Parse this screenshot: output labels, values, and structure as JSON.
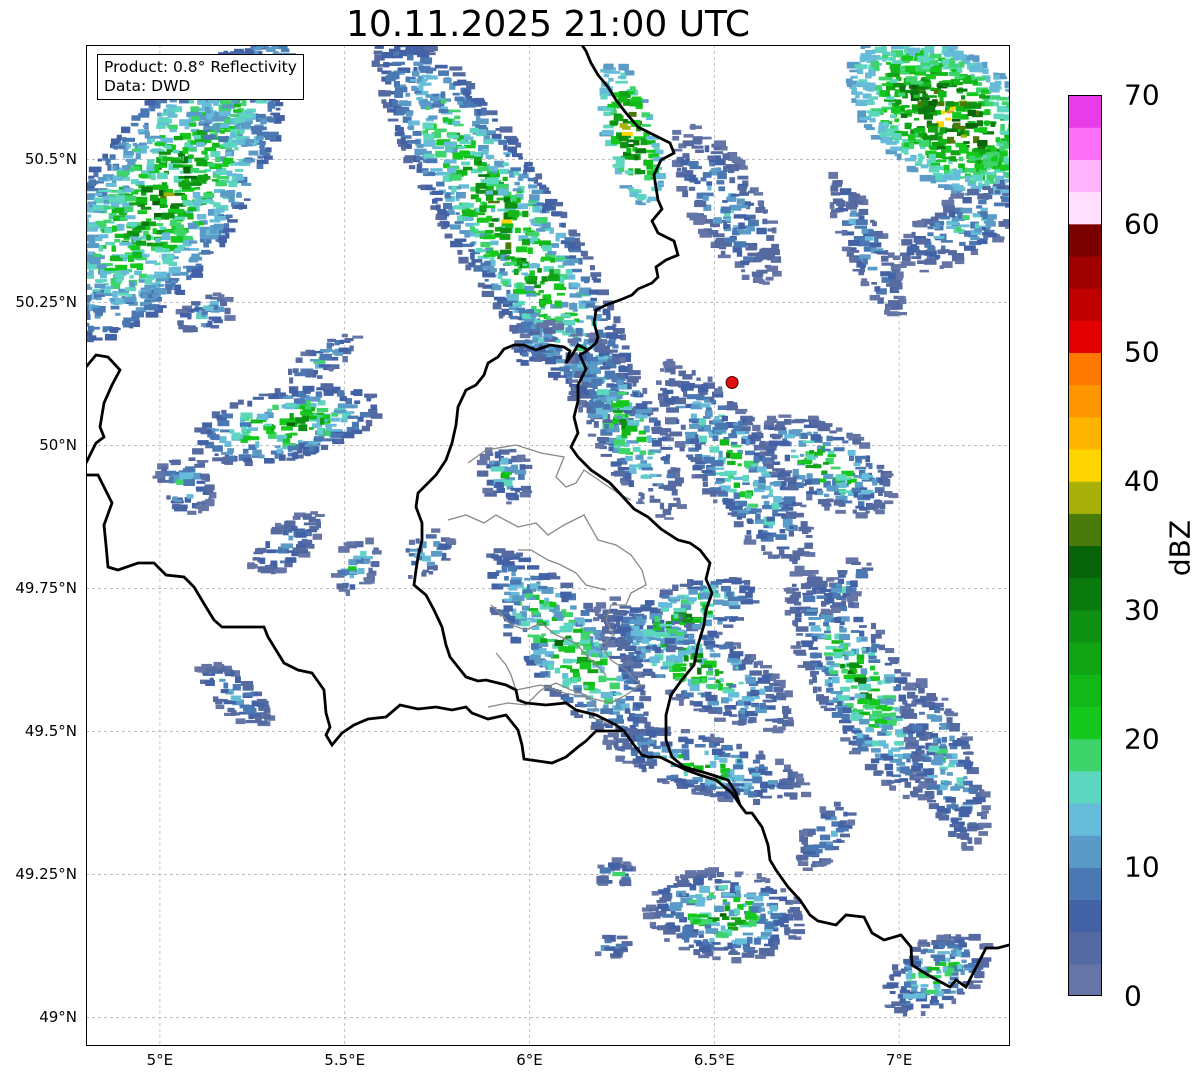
{
  "title": "10.11.2025 21:00 UTC",
  "info": {
    "product": "Product: 0.8° Reflectivity",
    "data": "Data: DWD"
  },
  "axes": {
    "lat_ticks": [
      {
        "value": 50.5,
        "label": "50.5°N"
      },
      {
        "value": 50.25,
        "label": "50.25°N"
      },
      {
        "value": 50.0,
        "label": "50°N"
      },
      {
        "value": 49.75,
        "label": "49.75°N"
      },
      {
        "value": 49.5,
        "label": "49.5°N"
      },
      {
        "value": 49.25,
        "label": "49.25°N"
      },
      {
        "value": 49.0,
        "label": "49°N"
      }
    ],
    "lon_ticks": [
      {
        "value": 5.0,
        "label": "5°E"
      },
      {
        "value": 5.5,
        "label": "5.5°E"
      },
      {
        "value": 6.0,
        "label": "6°E"
      },
      {
        "value": 6.5,
        "label": "6.5°E"
      },
      {
        "value": 7.0,
        "label": "7°E"
      }
    ],
    "lon_range": [
      4.8,
      7.3
    ],
    "lat_range": [
      48.95,
      50.7
    ],
    "gridlines": true
  },
  "colorbar": {
    "unit": "dBZ",
    "min": 0,
    "max": 70,
    "tick_labels": [
      "0",
      "10",
      "20",
      "30",
      "40",
      "50",
      "60",
      "70"
    ],
    "colors": [
      "#6475a6",
      "#546aa0",
      "#4362a6",
      "#4a78b2",
      "#5a9ac6",
      "#66bcd8",
      "#5cd6be",
      "#3ed46c",
      "#14c81e",
      "#12b818",
      "#10a414",
      "#0e9012",
      "#0a7a0e",
      "#086408",
      "#4a7a0a",
      "#a8b00a",
      "#ffd500",
      "#ffb400",
      "#ff9600",
      "#ff7800",
      "#e40000",
      "#c00000",
      "#a00000",
      "#7a0000",
      "#ffe0fc",
      "#ffb4fc",
      "#ff70f8",
      "#e83ce8"
    ]
  },
  "radar_site": {
    "lon": 6.548,
    "lat": 50.11,
    "color": "#dd1111"
  },
  "map_colors": {
    "border": "#000000",
    "district": "#888888",
    "grid": "#aaaaaa"
  }
}
